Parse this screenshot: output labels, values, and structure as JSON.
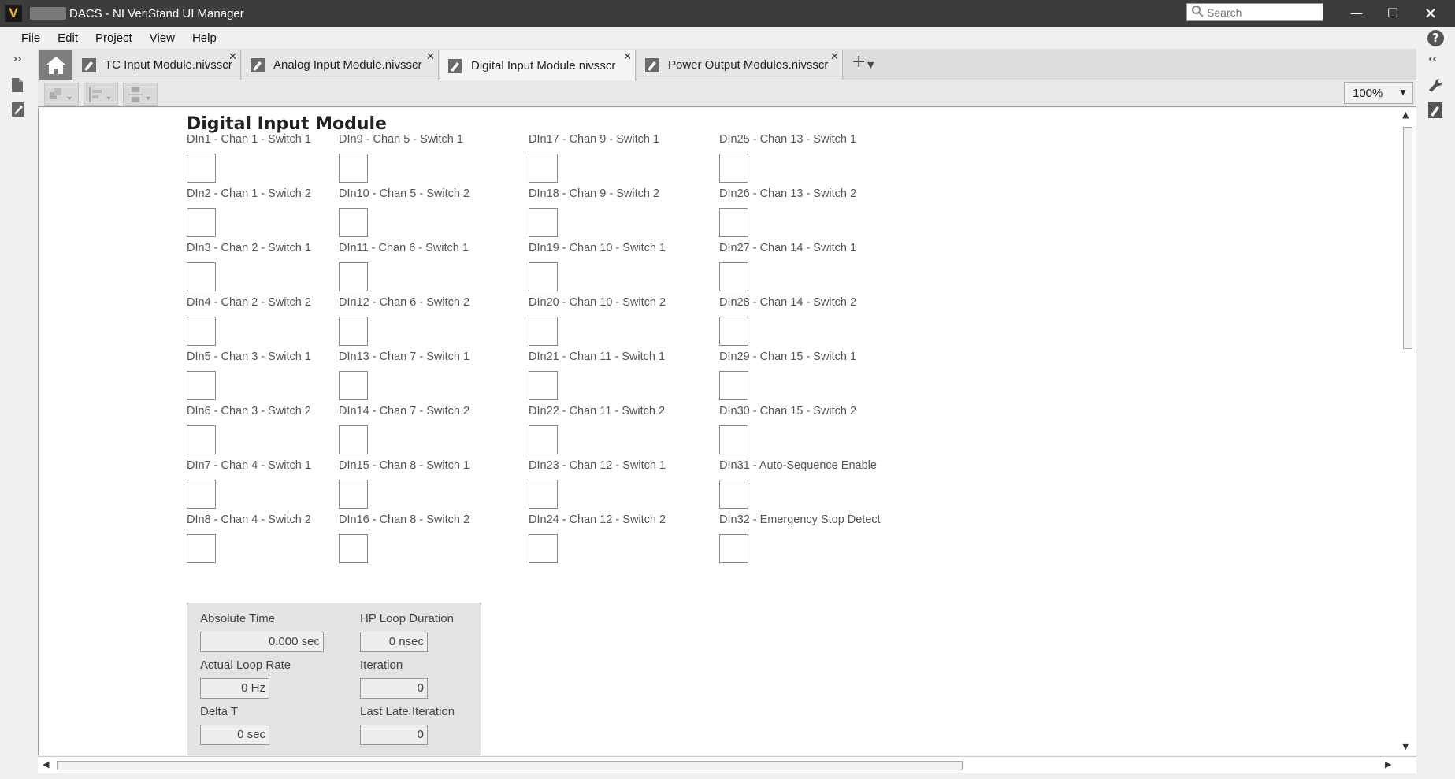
{
  "window": {
    "title": "DACS - NI VeriStand UI Manager",
    "search_placeholder": "Search",
    "minimize": "—",
    "maximize": "☐",
    "close": "✕"
  },
  "menu": [
    "File",
    "Edit",
    "Project",
    "View",
    "Help"
  ],
  "tabs": [
    {
      "label": "TC Input Module.nivsscr",
      "active": false
    },
    {
      "label": "Analog Input Module.nivsscr",
      "active": false
    },
    {
      "label": "Digital Input Module.nivsscr",
      "active": true
    },
    {
      "label": "Power Output Modules.nivsscr",
      "active": false
    }
  ],
  "toolbar": {
    "zoom": "100%"
  },
  "page": {
    "title": "Digital Input Module",
    "columns": [
      [
        "DIn1 - Chan 1 - Switch 1",
        "DIn2 - Chan 1 - Switch 2",
        "DIn3 - Chan 2 - Switch 1",
        "DIn4 - Chan 2 - Switch 2",
        "DIn5 - Chan 3 - Switch 1",
        "DIn6 - Chan 3 - Switch 2",
        "DIn7 - Chan 4 - Switch 1",
        "DIn8 - Chan 4 - Switch 2"
      ],
      [
        "DIn9 - Chan 5 - Switch 1",
        "DIn10 - Chan 5 - Switch 2",
        "DIn11 - Chan 6 - Switch 1",
        "DIn12 - Chan 6 - Switch 2",
        "DIn13 - Chan 7 - Switch 1",
        "DIn14 - Chan 7 - Switch 2",
        "DIn15 - Chan 8 - Switch 1",
        "DIn16 - Chan 8 - Switch 2"
      ],
      [
        "DIn17 - Chan 9 - Switch 1",
        "DIn18 - Chan 9 - Switch 2",
        "DIn19 - Chan 10 - Switch 1",
        "DIn20 - Chan 10 - Switch 2",
        "DIn21 - Chan 11 - Switch 1",
        "DIn22 - Chan 11 - Switch 2",
        "DIn23 - Chan 12 - Switch 1",
        "DIn24 - Chan 12 - Switch 2"
      ],
      [
        "DIn25 - Chan 13 - Switch 1",
        "DIn26 - Chan 13 - Switch 2",
        "DIn27 - Chan 14 - Switch 1",
        "DIn28 - Chan 14 - Switch 2",
        "DIn29 - Chan 15 - Switch 1",
        "DIn30 - Chan 15 - Switch 2",
        "DIn31 - Auto-Sequence Enable",
        "DIn32 - Emergency Stop Detect"
      ]
    ]
  },
  "timing": {
    "absolute_time_label": "Absolute Time",
    "absolute_time_value": "0.000 sec",
    "hp_loop_label": "HP Loop Duration",
    "hp_loop_value": "0 nsec",
    "loop_rate_label": "Actual Loop Rate",
    "loop_rate_value": "0 Hz",
    "iteration_label": "Iteration",
    "iteration_value": "0",
    "delta_t_label": "Delta T",
    "delta_t_value": "0 sec",
    "late_iteration_label": "Last Late Iteration",
    "late_iteration_value": "0"
  }
}
